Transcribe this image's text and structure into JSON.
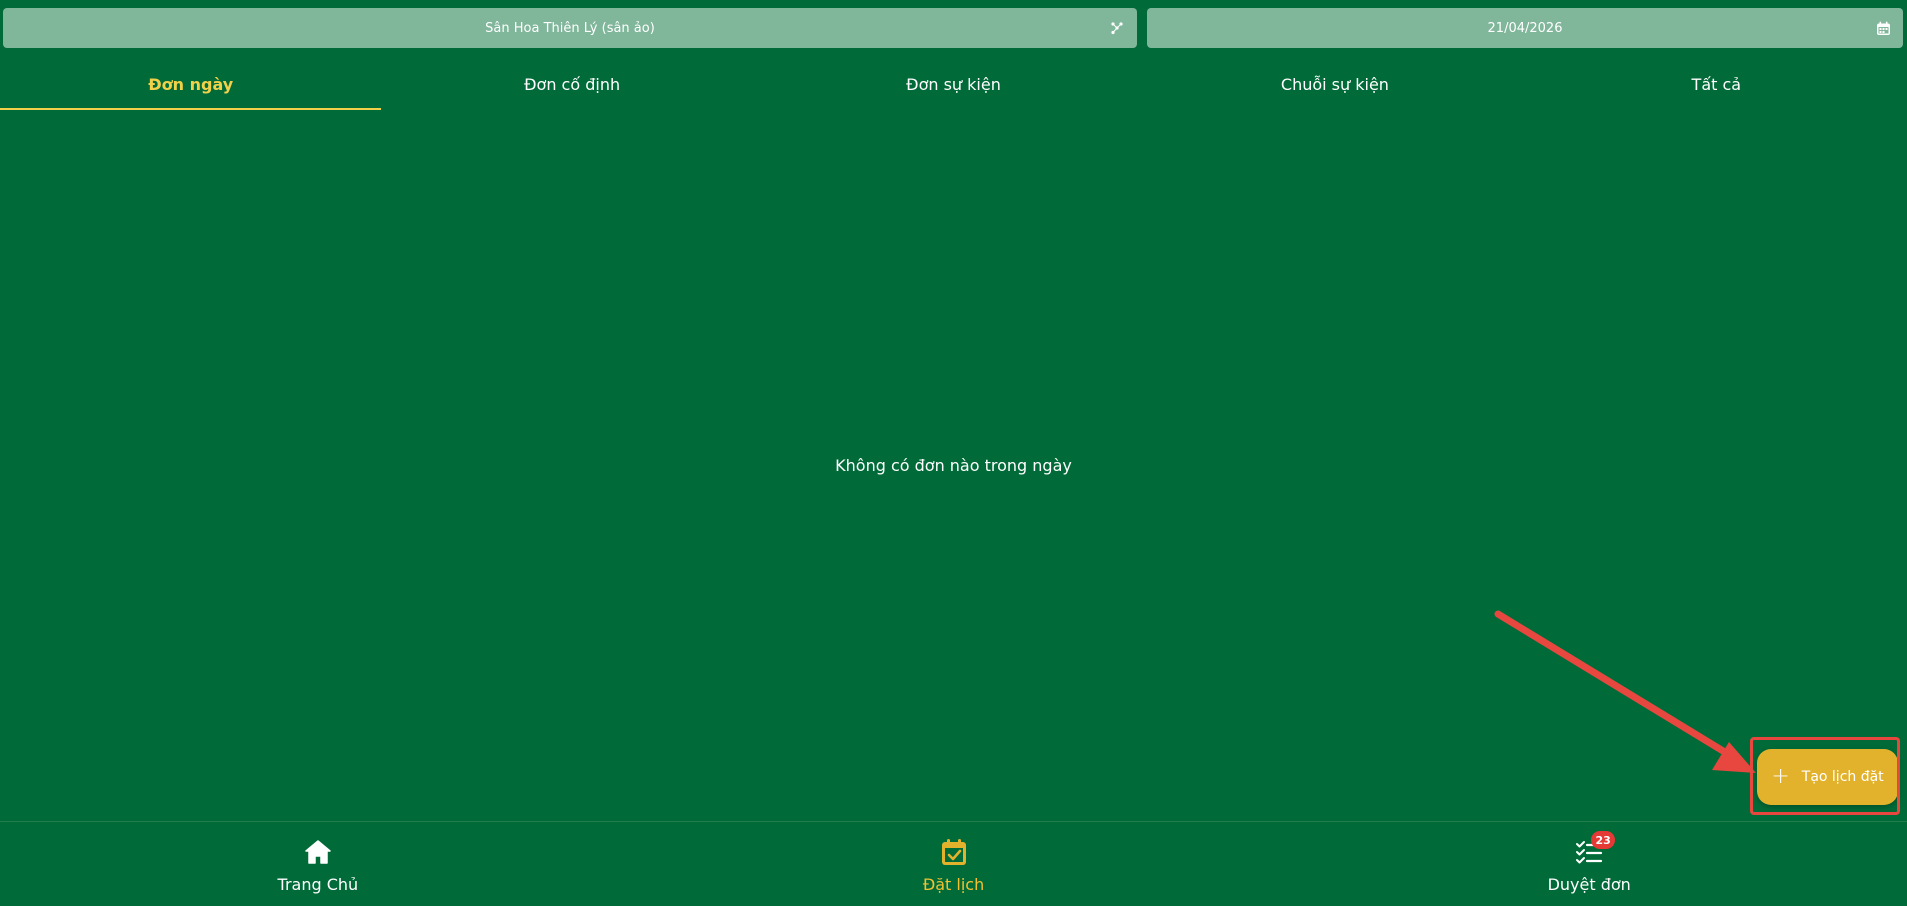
{
  "top_bar": {
    "field_select": {
      "value": "Sân Hoa Thiên Lý (sân ảo)",
      "icon": "tree-network-icon"
    },
    "date_select": {
      "value": "21/04/2026",
      "icon": "calendar-icon"
    }
  },
  "tabs": [
    {
      "label": "Đơn ngày",
      "active": true
    },
    {
      "label": "Đơn cố định",
      "active": false
    },
    {
      "label": "Đơn sự kiện",
      "active": false
    },
    {
      "label": "Chuỗi sự kiện",
      "active": false
    },
    {
      "label": "Tất cả",
      "active": false
    }
  ],
  "main": {
    "empty_message": "Không có đơn nào trong ngày"
  },
  "fab": {
    "label": "Tạo lịch đặt",
    "icon": "plus-icon"
  },
  "bottom_nav": [
    {
      "label": "Trang Chủ",
      "icon": "home-icon",
      "active": false
    },
    {
      "label": "Đặt lịch",
      "icon": "calendar-check-icon",
      "active": true
    },
    {
      "label": "Duyệt đơn",
      "icon": "checklist-icon",
      "active": false,
      "badge": "23"
    }
  ],
  "colors": {
    "background": "#006b38",
    "selector_bg": "#80b69a",
    "accent_yellow": "#f2d14a",
    "fab_bg": "#e3b22c",
    "badge_red": "#e53935",
    "annotation_red": "#e8473f"
  }
}
